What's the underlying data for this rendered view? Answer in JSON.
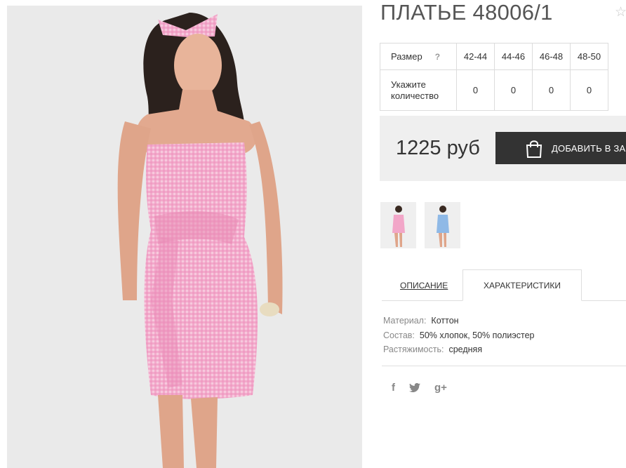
{
  "product": {
    "title": "ПЛАТЬЕ 48006/1",
    "price": "1225 руб",
    "add_to_cart": "ДОБАВИТЬ В ЗАКАЗ"
  },
  "size_table": {
    "size_label": "Размер",
    "help": "?",
    "qty_label": "Укажите количество",
    "sizes": [
      "42-44",
      "44-46",
      "46-48",
      "48-50"
    ],
    "quantities": [
      "0",
      "0",
      "0",
      "0"
    ]
  },
  "thumbnails": [
    {
      "color": "pink",
      "hex": "#f2a6c8"
    },
    {
      "color": "blue",
      "hex": "#8fb9e6"
    }
  ],
  "tabs": {
    "description": "ОПИСАНИЕ",
    "characteristics": "ХАРАКТЕРИСТИКИ"
  },
  "specs": [
    {
      "key": "Материал:",
      "value": "Коттон"
    },
    {
      "key": "Состав:",
      "value": "50% хлопок, 50% полиэстер"
    },
    {
      "key": "Растяжимость:",
      "value": "средняя"
    }
  ],
  "social": {
    "facebook": "f",
    "twitter": "twitter-icon",
    "google": "g+"
  },
  "colors": {
    "accent_dark": "#333333",
    "price_bg": "#efefef",
    "dress_pink": "#f2a6c8"
  }
}
